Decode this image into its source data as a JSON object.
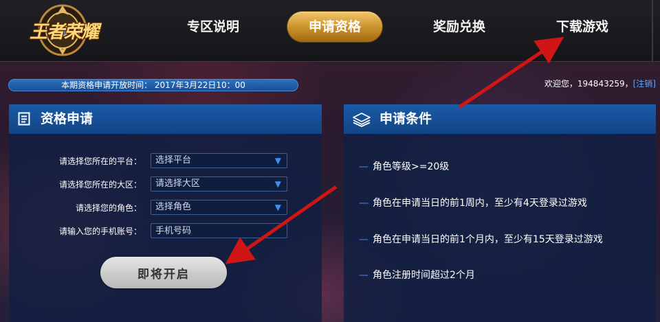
{
  "header": {
    "logo_text": "王者荣耀",
    "nav": [
      "专区说明",
      "申请资格",
      "奖励兑换",
      "下载游戏"
    ],
    "active_index": 1
  },
  "open_time": "本期资格申请开放时间： 2017年3月22日10：00",
  "welcome": {
    "text": "欢迎您，194843259，",
    "logout": "[注销]"
  },
  "apply_panel": {
    "title": "资格申请",
    "icon": "document-icon",
    "fields": [
      {
        "label": "请选择您所在的平台：",
        "value": "选择平台",
        "type": "select"
      },
      {
        "label": "请选择您所在的大区：",
        "value": "请选择大区",
        "type": "select"
      },
      {
        "label": "请选择您的角色：",
        "value": "选择角色",
        "type": "select"
      },
      {
        "label": "请输入您的手机账号：",
        "placeholder": "手机号码",
        "type": "input"
      }
    ],
    "button": "即将开启"
  },
  "conditions_panel": {
    "title": "申请条件",
    "icon": "layers-icon",
    "items": [
      "角色等级>=20级",
      "角色在申请当日的前1周内，至少有4天登录过游戏",
      "角色在申请当日的前1个月内，至少有15天登录过游戏",
      "角色注册时间超过2个月"
    ]
  },
  "colors": {
    "panel_header": "#1a5aa8",
    "active_nav": "#d9a23d",
    "accent_blue": "#3f8dee",
    "arrow_red": "#d01515"
  }
}
